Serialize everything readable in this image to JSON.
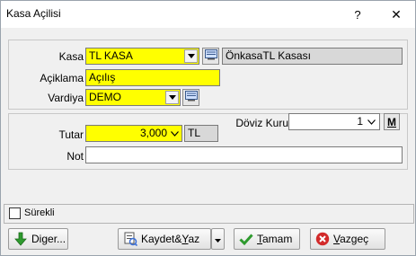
{
  "window": {
    "title": "Kasa Açilisi",
    "help_glyph": "?",
    "close_glyph": "✕"
  },
  "form": {
    "kasa": {
      "label": "Kasa",
      "value": "TL KASA",
      "description": "ÖnkasaTL Kasası"
    },
    "aciklama": {
      "label": "Açiklama",
      "value": "Açılış"
    },
    "vardiya": {
      "label": "Vardiya",
      "value": "DEMO"
    },
    "tutar": {
      "label": "Tutar",
      "value": "3,000",
      "currency": "TL"
    },
    "doviz_kuru": {
      "label": "Döviz Kuru",
      "value": "1",
      "m_button": "M"
    },
    "not": {
      "label": "Not",
      "value": ""
    }
  },
  "options": {
    "surekli_label": "Sürekli",
    "surekli_checked": false
  },
  "buttons": {
    "diger": {
      "prefix": "Di",
      "underline": "g",
      "suffix": "er..."
    },
    "kaydet_yaz": {
      "prefix": "Kaydet&",
      "underline": "Y",
      "suffix": "az"
    },
    "tamam": {
      "prefix": "",
      "underline": "T",
      "suffix": "amam"
    },
    "vazgec": {
      "prefix": "",
      "underline": "V",
      "suffix": "azgeç"
    }
  },
  "colors": {
    "required_field": "#ffff00",
    "readonly_field": "#d8d8d8",
    "ok_green": "#2e9a2e",
    "cancel_red": "#d22a2a"
  },
  "icons": {
    "lookup": "lookup-icon",
    "dropdown": "chevron-down-icon",
    "down_arrow": "arrow-down-icon",
    "save_print": "save-print-icon",
    "check": "check-icon",
    "cancel": "cancel-icon"
  }
}
